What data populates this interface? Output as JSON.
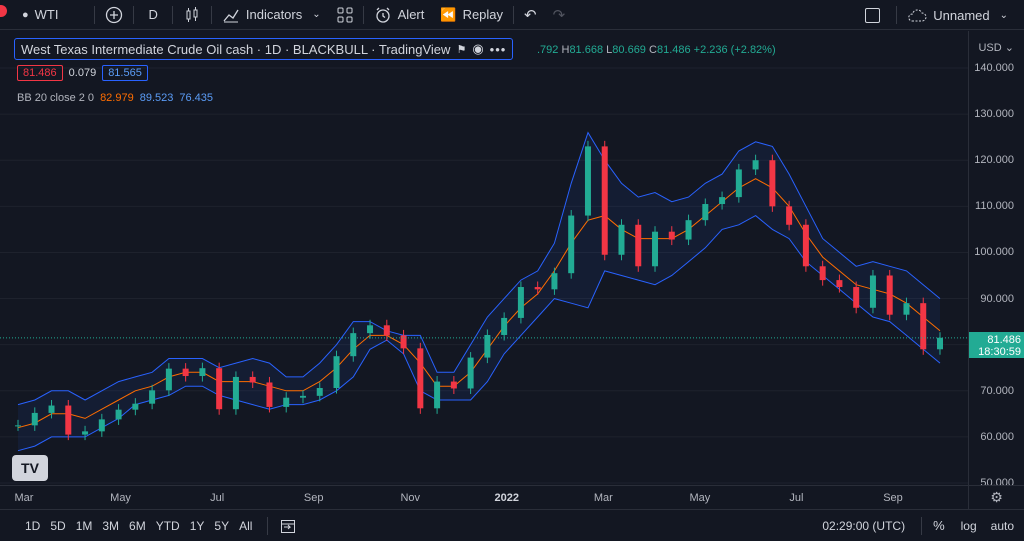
{
  "toolbar": {
    "symbol": "WTI",
    "interval": "D",
    "indicators_label": "Indicators",
    "alert_label": "Alert",
    "replay_label": "Replay",
    "layout_name": "Unnamed"
  },
  "legend": {
    "title": "West Texas Intermediate Crude Oil cash · 1D · BLACKBULL · TradingView",
    "ohlc_open_partial": ".792",
    "ohlc_high_label": "H",
    "ohlc_high": "81.668",
    "ohlc_low_label": "L",
    "ohlc_low": "80.669",
    "ohlc_close_label": "C",
    "ohlc_close": "81.486",
    "ohlc_change": "+2.236 (+2.82%)",
    "bid": "81.486",
    "spread": "0.079",
    "ask": "81.565",
    "bb_name": "BB 20 close 2 0",
    "bb_basis": "82.979",
    "bb_upper": "89.523",
    "bb_lower": "76.435"
  },
  "price_axis": {
    "currency": "USD",
    "ticks": [
      "140.000",
      "130.000",
      "120.000",
      "110.000",
      "100.000",
      "90.000",
      "80.000",
      "70.000",
      "60.000",
      "50.000"
    ],
    "last_price": "81.486",
    "countdown": "18:30:59"
  },
  "time_axis": {
    "ticks": [
      "Mar",
      "May",
      "Jul",
      "Sep",
      "Nov",
      "2022",
      "Mar",
      "May",
      "Jul",
      "Sep"
    ]
  },
  "bottom": {
    "ranges": [
      "1D",
      "5D",
      "1M",
      "3M",
      "6M",
      "YTD",
      "1Y",
      "5Y",
      "All"
    ],
    "clock": "02:29:00 (UTC)",
    "percent": "%",
    "log": "log",
    "auto": "auto"
  },
  "colors": {
    "up": "#22ab94",
    "down": "#f23645",
    "bb_band": "#2962ff",
    "bb_basis": "#ff6d00",
    "background": "#131722"
  },
  "chart_data": {
    "type": "candlestick",
    "ylim": [
      50,
      140
    ],
    "series": [
      {
        "name": "Price",
        "points": [
          [
            0,
            62.5
          ],
          [
            1,
            65.2
          ],
          [
            2,
            66.8
          ],
          [
            3,
            60.5
          ],
          [
            4,
            61.2
          ],
          [
            5,
            63.8
          ],
          [
            6,
            65.9
          ],
          [
            7,
            67.2
          ],
          [
            8,
            70.1
          ],
          [
            9,
            74.8
          ],
          [
            10,
            73.2
          ],
          [
            11,
            74.9
          ],
          [
            12,
            66.0
          ],
          [
            13,
            73.0
          ],
          [
            14,
            71.8
          ],
          [
            15,
            66.5
          ],
          [
            16,
            68.5
          ],
          [
            17,
            68.9
          ],
          [
            18,
            70.6
          ],
          [
            19,
            77.5
          ],
          [
            20,
            82.5
          ],
          [
            21,
            84.2
          ],
          [
            22,
            82.0
          ],
          [
            23,
            79.2
          ],
          [
            24,
            66.2
          ],
          [
            25,
            72.0
          ],
          [
            26,
            70.5
          ],
          [
            27,
            77.2
          ],
          [
            28,
            82.1
          ],
          [
            29,
            85.8
          ],
          [
            30,
            92.5
          ],
          [
            31,
            92.0
          ],
          [
            32,
            95.5
          ],
          [
            33,
            108.0
          ],
          [
            34,
            123.0
          ],
          [
            35,
            99.5
          ],
          [
            36,
            106.0
          ],
          [
            37,
            97.0
          ],
          [
            38,
            104.5
          ],
          [
            39,
            102.8
          ],
          [
            40,
            107.0
          ],
          [
            41,
            110.5
          ],
          [
            42,
            112.0
          ],
          [
            43,
            118.0
          ],
          [
            44,
            120.0
          ],
          [
            45,
            110.0
          ],
          [
            46,
            106.0
          ],
          [
            47,
            97.0
          ],
          [
            48,
            94.0
          ],
          [
            49,
            92.5
          ],
          [
            50,
            88.0
          ],
          [
            51,
            95.0
          ],
          [
            52,
            86.5
          ],
          [
            53,
            89.0
          ],
          [
            54,
            79.0
          ],
          [
            55,
            81.5
          ]
        ]
      },
      {
        "name": "BB Upper",
        "points": [
          [
            0,
            67
          ],
          [
            1,
            68
          ],
          [
            2,
            70
          ],
          [
            3,
            70
          ],
          [
            4,
            68
          ],
          [
            5,
            70
          ],
          [
            6,
            72
          ],
          [
            7,
            73
          ],
          [
            8,
            74
          ],
          [
            9,
            77
          ],
          [
            10,
            77
          ],
          [
            11,
            77
          ],
          [
            12,
            75
          ],
          [
            13,
            76
          ],
          [
            14,
            77
          ],
          [
            15,
            76
          ],
          [
            16,
            73
          ],
          [
            17,
            73
          ],
          [
            18,
            76
          ],
          [
            19,
            80
          ],
          [
            20,
            85
          ],
          [
            21,
            85
          ],
          [
            22,
            83
          ],
          [
            23,
            82
          ],
          [
            24,
            82
          ],
          [
            25,
            74
          ],
          [
            26,
            74
          ],
          [
            27,
            80
          ],
          [
            28,
            86
          ],
          [
            29,
            90
          ],
          [
            30,
            94
          ],
          [
            31,
            96
          ],
          [
            32,
            102
          ],
          [
            33,
            115
          ],
          [
            34,
            126
          ],
          [
            35,
            120
          ],
          [
            36,
            115
          ],
          [
            37,
            112
          ],
          [
            38,
            113
          ],
          [
            39,
            111
          ],
          [
            40,
            112
          ],
          [
            41,
            115
          ],
          [
            42,
            117
          ],
          [
            43,
            122
          ],
          [
            44,
            124
          ],
          [
            45,
            123
          ],
          [
            46,
            117
          ],
          [
            47,
            110
          ],
          [
            48,
            103
          ],
          [
            49,
            100
          ],
          [
            50,
            97
          ],
          [
            51,
            98
          ],
          [
            52,
            97
          ],
          [
            53,
            96
          ],
          [
            54,
            93
          ],
          [
            55,
            90
          ]
        ]
      },
      {
        "name": "BB Basis",
        "points": [
          [
            0,
            62
          ],
          [
            1,
            63
          ],
          [
            2,
            65
          ],
          [
            3,
            65
          ],
          [
            4,
            64
          ],
          [
            5,
            66
          ],
          [
            6,
            68
          ],
          [
            7,
            70
          ],
          [
            8,
            71
          ],
          [
            9,
            73
          ],
          [
            10,
            74
          ],
          [
            11,
            74
          ],
          [
            12,
            72
          ],
          [
            13,
            72
          ],
          [
            14,
            72
          ],
          [
            15,
            71
          ],
          [
            16,
            70
          ],
          [
            17,
            70
          ],
          [
            18,
            72
          ],
          [
            19,
            75
          ],
          [
            20,
            79
          ],
          [
            21,
            82
          ],
          [
            22,
            82
          ],
          [
            23,
            80
          ],
          [
            24,
            76
          ],
          [
            25,
            71
          ],
          [
            26,
            71
          ],
          [
            27,
            74
          ],
          [
            28,
            79
          ],
          [
            29,
            84
          ],
          [
            30,
            88
          ],
          [
            31,
            91
          ],
          [
            32,
            96
          ],
          [
            33,
            102
          ],
          [
            34,
            107
          ],
          [
            35,
            108
          ],
          [
            36,
            105
          ],
          [
            37,
            103
          ],
          [
            38,
            103
          ],
          [
            39,
            103
          ],
          [
            40,
            105
          ],
          [
            41,
            108
          ],
          [
            42,
            111
          ],
          [
            43,
            114
          ],
          [
            44,
            116
          ],
          [
            45,
            114
          ],
          [
            46,
            110
          ],
          [
            47,
            104
          ],
          [
            48,
            99
          ],
          [
            49,
            96
          ],
          [
            50,
            93
          ],
          [
            51,
            92
          ],
          [
            52,
            91
          ],
          [
            53,
            89
          ],
          [
            54,
            86
          ],
          [
            55,
            83
          ]
        ]
      },
      {
        "name": "BB Lower",
        "points": [
          [
            0,
            57
          ],
          [
            1,
            58
          ],
          [
            2,
            60
          ],
          [
            3,
            60
          ],
          [
            4,
            60
          ],
          [
            5,
            62
          ],
          [
            6,
            64
          ],
          [
            7,
            67
          ],
          [
            8,
            68
          ],
          [
            9,
            69
          ],
          [
            10,
            71
          ],
          [
            11,
            71
          ],
          [
            12,
            69
          ],
          [
            13,
            68
          ],
          [
            14,
            67
          ],
          [
            15,
            66
          ],
          [
            16,
            67
          ],
          [
            17,
            67
          ],
          [
            18,
            68
          ],
          [
            19,
            70
          ],
          [
            20,
            73
          ],
          [
            21,
            79
          ],
          [
            22,
            81
          ],
          [
            23,
            78
          ],
          [
            24,
            70
          ],
          [
            25,
            68
          ],
          [
            26,
            68
          ],
          [
            27,
            68
          ],
          [
            28,
            72
          ],
          [
            29,
            78
          ],
          [
            30,
            82
          ],
          [
            31,
            86
          ],
          [
            32,
            90
          ],
          [
            33,
            89
          ],
          [
            34,
            88
          ],
          [
            35,
            96
          ],
          [
            36,
            95
          ],
          [
            37,
            94
          ],
          [
            38,
            93
          ],
          [
            39,
            95
          ],
          [
            40,
            98
          ],
          [
            41,
            101
          ],
          [
            42,
            105
          ],
          [
            43,
            106
          ],
          [
            44,
            108
          ],
          [
            45,
            105
          ],
          [
            46,
            103
          ],
          [
            47,
            98
          ],
          [
            48,
            95
          ],
          [
            49,
            92
          ],
          [
            50,
            89
          ],
          [
            51,
            86
          ],
          [
            52,
            85
          ],
          [
            53,
            82
          ],
          [
            54,
            79
          ],
          [
            55,
            76
          ]
        ]
      }
    ]
  }
}
